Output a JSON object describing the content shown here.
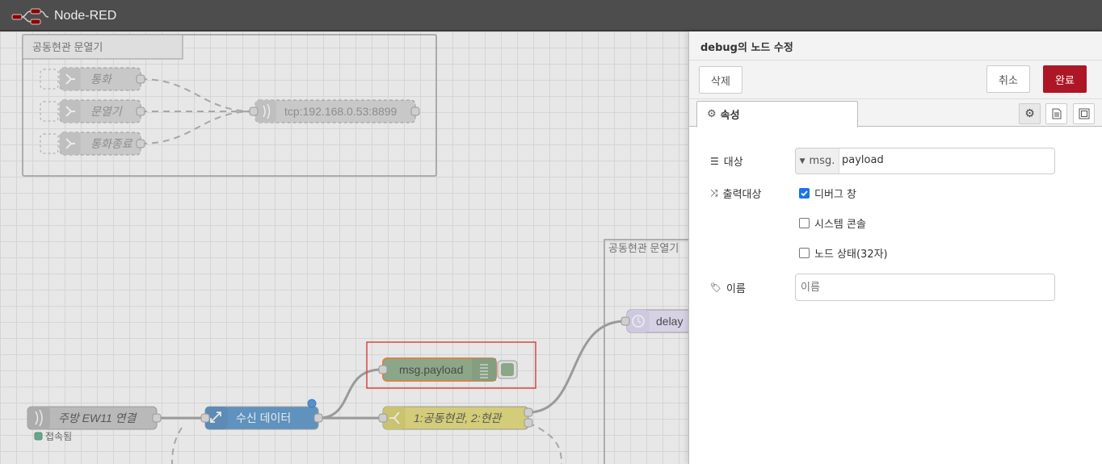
{
  "app": {
    "title": "Node-RED"
  },
  "workspace": {
    "groups": [
      {
        "label": "공동현관 문열기"
      },
      {
        "label": "공동현관 문열기"
      }
    ],
    "disabled_nodes": [
      {
        "label": "통화"
      },
      {
        "label": "문열기"
      },
      {
        "label": "통화종료"
      },
      {
        "label": "tcp:192.168.0.53:8899"
      }
    ],
    "nodes": {
      "tcp_in": {
        "label": "주방 EW11 연결",
        "status": "접속됨"
      },
      "function": {
        "label": "수신 데이터"
      },
      "debug": {
        "label": "msg.payload"
      },
      "switch": {
        "label": "1:공동현관, 2:현관"
      },
      "delay": {
        "label": "delay"
      }
    }
  },
  "tray": {
    "title": "debug의 노드 수정",
    "delete_label": "삭제",
    "cancel_label": "취소",
    "done_label": "완료",
    "tab_properties": "속성",
    "form": {
      "target_label": "대상",
      "target_type": "msg.",
      "target_value": "payload",
      "output_label": "출력대상",
      "options": [
        {
          "label": "디버그 창",
          "checked": true
        },
        {
          "label": "시스템 콘솔",
          "checked": false
        },
        {
          "label": "노드 상태(32자)",
          "checked": false
        }
      ],
      "name_label": "이름",
      "name_placeholder": "이름"
    },
    "colors": {
      "done": "#ad1625",
      "checkbox": "#1a73e8"
    }
  }
}
